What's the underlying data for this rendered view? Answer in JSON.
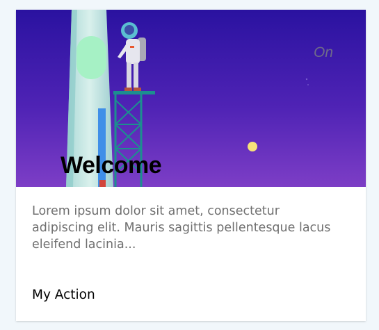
{
  "card": {
    "title": "Welcome",
    "badge": "On",
    "description": "Lorem ipsum dolor sit amet, consectetur adipiscing elit. Mauris sagittis pellentesque lacus eleifend lacinia...",
    "action_label": "My Action"
  },
  "colors": {
    "sky_top": "#2a12a0",
    "sky_bottom": "#7a3bc2",
    "tower": "#c9e7e2",
    "scaffold": "#1c8f8f",
    "capsule": "#a6f1c5",
    "moon": "#f6e27a"
  },
  "icons": {
    "illustration": "astronaut-on-tower-illustration"
  }
}
